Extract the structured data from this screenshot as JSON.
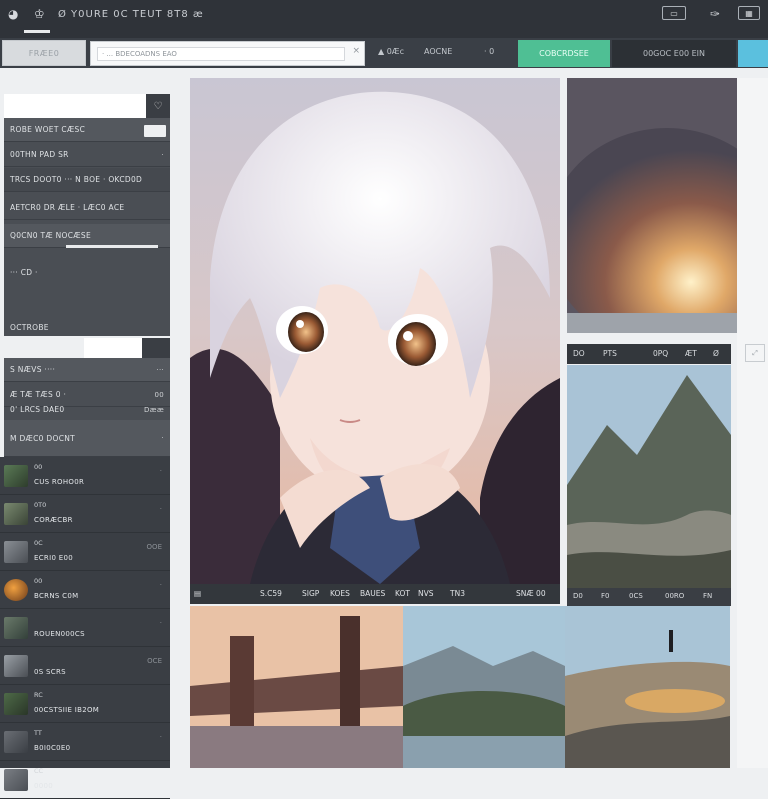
{
  "topbar": {
    "title": "Ø Y0URE 0C TEUT 8T8 æ",
    "icons": [
      "circle-icon",
      "person-icon"
    ],
    "right_icons": [
      "display-icon",
      "brush-icon",
      "window-icon"
    ]
  },
  "toolbar": {
    "tab1": "FRÆE0",
    "search_text": "· ... BDECOADNS EAO",
    "nav1": "▲  0Æc",
    "nav2": "AOCNE",
    "nav3": "· 0",
    "green_button": "COBCRDSEE",
    "dark_button": "00GOC E00 EIN",
    "blue_button": ""
  },
  "sidebar": {
    "header_value": "",
    "rows": [
      {
        "label": "ROBE  WOET CÆSC",
        "right": "··"
      },
      {
        "label": "00THN PAD SR",
        "right": "·"
      },
      {
        "label": "TRCS DOOT0  ···  N  BOE  · OKCD0D",
        "right": ""
      },
      {
        "label": "AETCR0 DR ÆLE  · LÆC0 ACE",
        "right": ""
      },
      {
        "label": "Q0CN0     TÆ      NOCÆSE",
        "right": ""
      },
      {
        "label": "",
        "right": ""
      },
      {
        "label": "",
        "right": ""
      },
      {
        "label": "··· CD  ·",
        "right": ""
      },
      {
        "label": "OCTROBE",
        "right": ""
      }
    ],
    "section2": [
      {
        "label": "S  NÆVS  ····",
        "right": "···"
      },
      {
        "label": "Æ TÆ TÆS  0 ·",
        "right": "00"
      },
      {
        "label": "0' LRCS  DAE0",
        "right": "Dææ"
      },
      {
        "label": "M  DÆC0  DOCNT",
        "right": "·"
      }
    ],
    "list": [
      {
        "num": "00",
        "name": "CUS ROHO0R",
        "mark": "·"
      },
      {
        "num": "0T0",
        "name": "CORÆCBR",
        "mark": "·"
      },
      {
        "num": "0C",
        "name": "ECRI0 E00",
        "mark": "OOE"
      },
      {
        "num": "00",
        "name": "BCRNS C0M",
        "mark": "·"
      },
      {
        "num": "",
        "name": "ROUEN000CS",
        "mark": "·"
      },
      {
        "num": "",
        "name": "0S  SCRS",
        "mark": "OCE"
      },
      {
        "num": "RC",
        "name": "00CSTSIIE IB2OM",
        "mark": ""
      },
      {
        "num": "TT",
        "name": "B0I0C0E0",
        "mark": "·"
      },
      {
        "num": "CC",
        "name": "0000",
        "mark": ""
      }
    ]
  },
  "main": {
    "caption": [
      "S.C59",
      "SIGP",
      "KOES",
      "BAUES",
      "KOT",
      "NVS",
      "TN3",
      "SNÆ 00"
    ]
  },
  "side": {
    "bar2": [
      "DO",
      "PTS",
      "0PQ",
      "ÆT",
      "Ø"
    ],
    "bar3": [
      "D0",
      "F0",
      "0CS",
      "00RO",
      "FN"
    ]
  },
  "colors": {
    "accent_green": "#4fbf94",
    "accent_blue": "#5bc0de",
    "panel_dark": "#3a3e44"
  }
}
